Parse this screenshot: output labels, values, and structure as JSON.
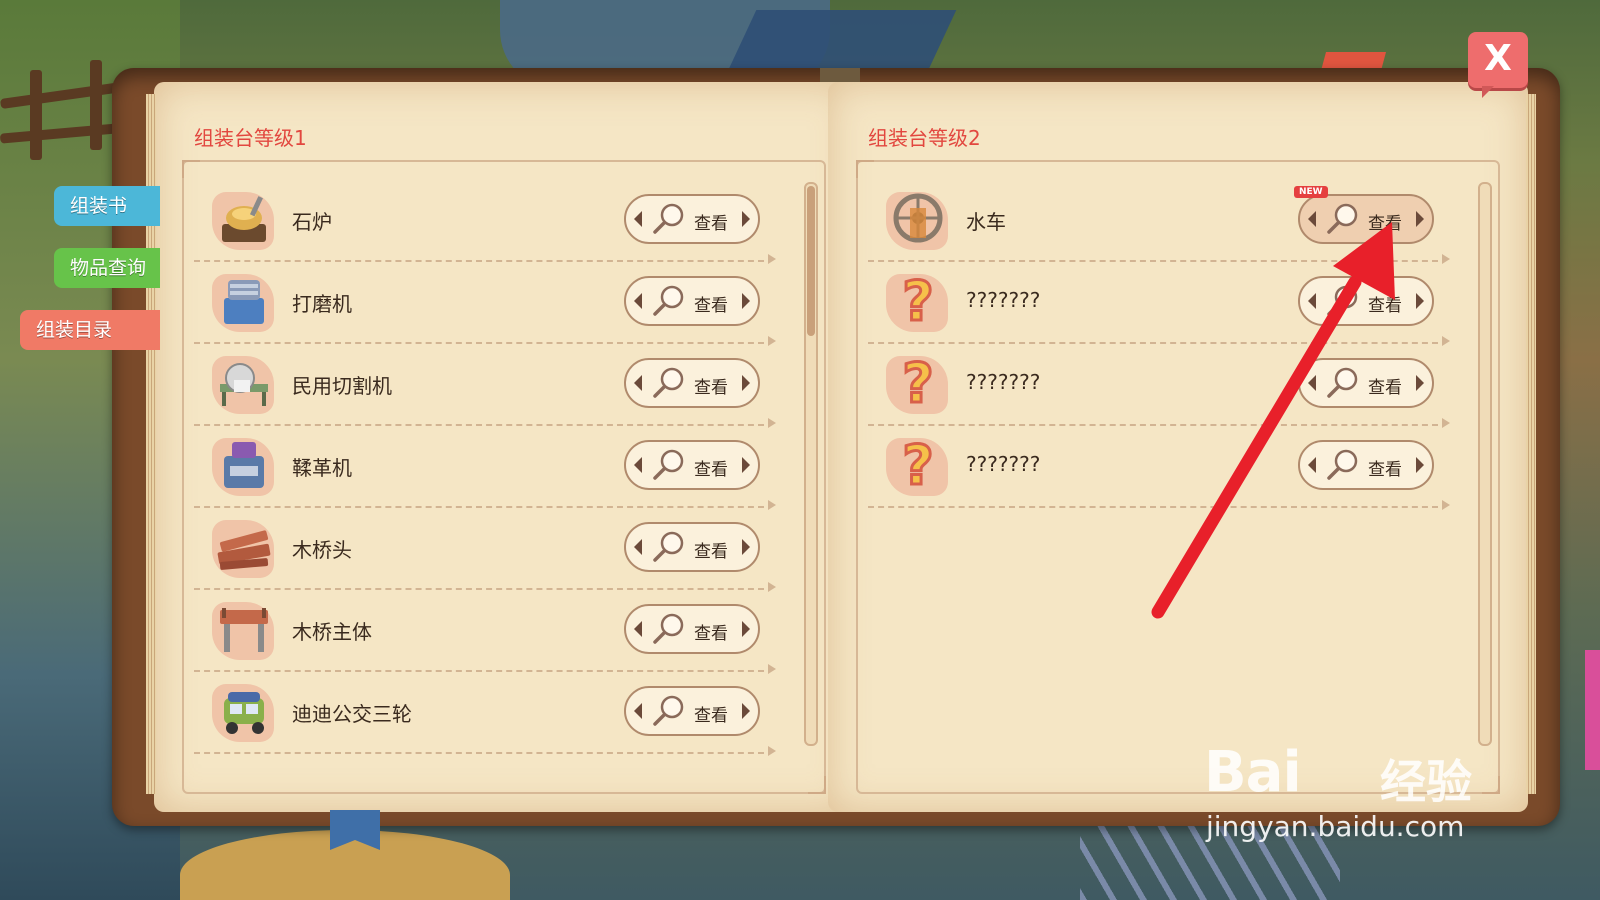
{
  "tabs": [
    {
      "label": "组装书",
      "color": "#4cb7d8"
    },
    {
      "label": "物品查询",
      "color": "#67c34a"
    },
    {
      "label": "组装目录",
      "color": "#f07a66"
    }
  ],
  "close_label": "X",
  "left_page": {
    "title": "组装台等级1",
    "items": [
      {
        "name": "石炉",
        "icon": "stone-furnace-icon",
        "button": "查看"
      },
      {
        "name": "打磨机",
        "icon": "grinder-icon",
        "button": "查看"
      },
      {
        "name": "民用切割机",
        "icon": "cutting-machine-icon",
        "button": "查看"
      },
      {
        "name": "鞣革机",
        "icon": "tanning-machine-icon",
        "button": "查看"
      },
      {
        "name": "木桥头",
        "icon": "bridge-head-icon",
        "button": "查看"
      },
      {
        "name": "木桥主体",
        "icon": "bridge-body-icon",
        "button": "查看"
      },
      {
        "name": "迪迪公交三轮",
        "icon": "tricycle-icon",
        "button": "查看"
      }
    ]
  },
  "right_page": {
    "title": "组装台等级2",
    "items": [
      {
        "name": "水车",
        "icon": "water-wheel-icon",
        "button": "查看",
        "badge": "NEW"
      },
      {
        "name": "???????",
        "icon": "question-mark-icon",
        "button": "查看"
      },
      {
        "name": "???????",
        "icon": "question-mark-icon",
        "button": "查看"
      },
      {
        "name": "???????",
        "icon": "question-mark-icon",
        "button": "查看"
      }
    ]
  },
  "watermark": {
    "logo": "Bai",
    "logo_suffix": "经验",
    "url": "jingyan.baidu.com"
  },
  "annotation_color": "#e8202a"
}
